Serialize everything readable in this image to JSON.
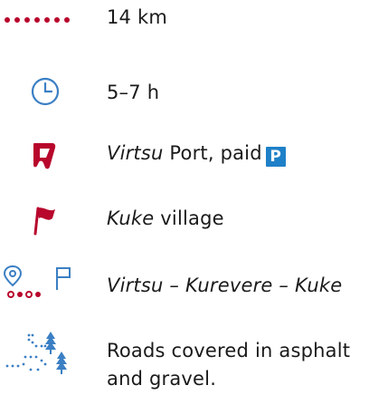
{
  "distance": "14 km",
  "duration": "5–7 h",
  "start": {
    "place": "Virtsu",
    "suffix": " Port, paid",
    "parking_badge": "P",
    "icon": "start-flag-icon"
  },
  "finish": {
    "place": "Kuke",
    "suffix": " village",
    "icon": "finish-flag-icon"
  },
  "route": "Virtsu – Kurevere – Kuke",
  "surface": "Roads covered in asphalt and gravel.",
  "icons": {
    "distance": "dotted-line-icon",
    "duration": "clock-icon",
    "route": "route-icon",
    "surface": "dotted-path-trees-icon"
  },
  "colors": {
    "icon_red": "#b8062c",
    "icon_blue": "#3b7fc4",
    "parking_blue": "#1e80c8"
  }
}
